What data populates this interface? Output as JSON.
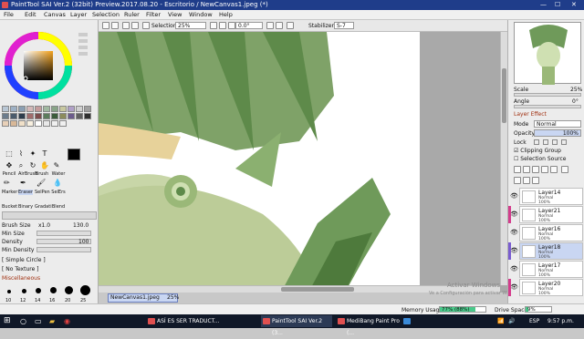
{
  "window": {
    "title": "PaintTool SAI Ver.2 (32bit) Preview.2017.08.20 - Escritorio / NewCanvas1.jpeg (*)"
  },
  "menu": [
    "File",
    "Edit",
    "Canvas",
    "Layer",
    "Selection",
    "Ruler",
    "Filter",
    "View",
    "Window",
    "Help"
  ],
  "toolbar": {
    "selection_label": "Selection",
    "zoom": "25%",
    "angle": "0.0°",
    "stabilizer_label": "Stabilizer",
    "stabilizer": "S-7"
  },
  "tools": {
    "row1": [
      "Pencil",
      "AirBrush",
      "Brush",
      "Water"
    ],
    "row2": [
      "Marker",
      "Eraser",
      "SelPen",
      "SelErs"
    ],
    "row3": [
      "Bucket",
      "Binary",
      "Gradati",
      "Blend"
    ]
  },
  "brush": {
    "size_label": "Brush Size",
    "size_mult": "x1.0",
    "size_value": "130.0",
    "min_size_label": "Min Size",
    "min_size_value": "0%",
    "density_label": "Density",
    "density_value": "100",
    "min_density_label": "Min Density",
    "min_density_value": "0%",
    "shape": "[ Simple Circle ]",
    "texture": "[ No Texture ]",
    "misc_label": "Miscellaneous",
    "presets": [
      "10",
      "12",
      "14",
      "16",
      "20",
      "25"
    ]
  },
  "navigator": {
    "scale_label": "Scale",
    "scale_value": "25%",
    "angle_label": "Angle",
    "angle_value": "0°"
  },
  "layer_panel": {
    "effect_label": "Layer Effect",
    "mode_label": "Mode",
    "mode_value": "Normal",
    "opacity_label": "Opacity",
    "opacity_value": "100%",
    "lock_label": "Lock",
    "clipping": "Clipping Group",
    "selection_source": "Selection Source"
  },
  "layers": [
    {
      "name": "Layer14",
      "mode": "Normal",
      "opacity": "100%",
      "selected": false,
      "marker": ""
    },
    {
      "name": "Layer21",
      "mode": "Normal",
      "opacity": "100%",
      "selected": false,
      "marker": "#d43c8c"
    },
    {
      "name": "Layer16",
      "mode": "Normal",
      "opacity": "100%",
      "selected": false,
      "marker": ""
    },
    {
      "name": "Layer18",
      "mode": "Normal",
      "opacity": "100%",
      "selected": true,
      "marker": "#7a5cd0"
    },
    {
      "name": "Layer17",
      "mode": "Normal",
      "opacity": "100%",
      "selected": false,
      "marker": ""
    },
    {
      "name": "Layer20",
      "mode": "Normal",
      "opacity": "100%",
      "selected": false,
      "marker": "#d43c8c"
    }
  ],
  "document_tab": {
    "name": "NewCanvas1.jpeg",
    "zoom": "25%"
  },
  "status": {
    "memory_label": "Memory Usage",
    "memory_value": "77% (88%)",
    "memory_fraction": 0.77,
    "drive_label": "Drive Space",
    "drive_value": "9%",
    "drive_fraction": 0.09
  },
  "watermark": {
    "line1": "Activar Windows",
    "line2": "Ve a Configuración para activar Windows."
  },
  "taskbar": {
    "items": [
      "ASÍ ES SER TRADUCT...",
      "PaintTool SAI Ver.2 (3...",
      "MediBang Paint Pro (..."
    ],
    "lang": "ESP",
    "time": "9:57 p.m."
  }
}
